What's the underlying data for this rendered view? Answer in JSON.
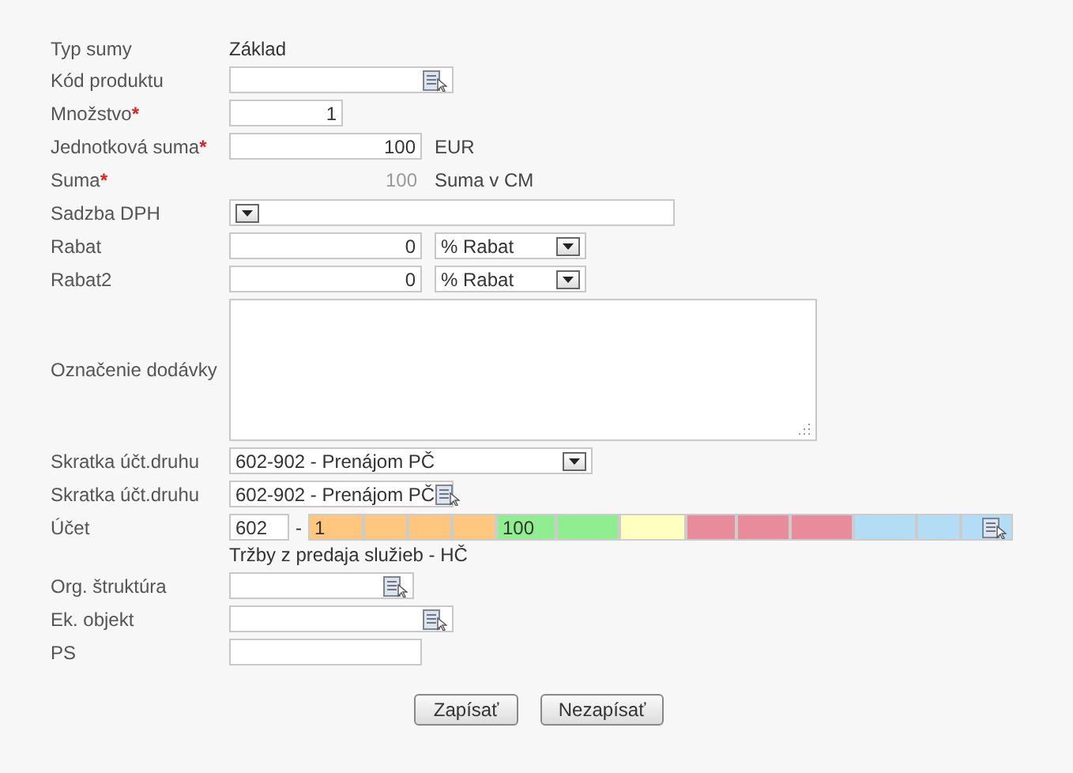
{
  "fields": [
    {
      "kind": "static",
      "label": "Typ sumy",
      "value": "Základ"
    },
    {
      "kind": "lookup",
      "label": "Kód produktu"
    },
    {
      "kind": "number",
      "label": "Množstvo",
      "required_mark": "*",
      "value": "1"
    },
    {
      "kind": "number",
      "label": "Jednotková suma",
      "required_mark": "*",
      "value": "100",
      "unit": "EUR"
    },
    {
      "kind": "readonly",
      "label": "Suma",
      "required_mark": "*",
      "value": "100",
      "unit": "Suma v CM"
    },
    {
      "kind": "select",
      "label": "Sadzba DPH"
    },
    {
      "kind": "number_select",
      "label": "Rabat",
      "value": "0",
      "option": "% Rabat"
    },
    {
      "kind": "number_select",
      "label": "Rabat2",
      "value": "0",
      "option": "% Rabat"
    },
    {
      "kind": "textarea",
      "label": "Označenie dodávky"
    },
    {
      "kind": "select",
      "label": "Skratka účt.druhu",
      "value": "602-902 - Prenájom PČ"
    },
    {
      "kind": "lookup",
      "label": "Skratka účt.druhu",
      "value": "602-902 - Prenájom PČ"
    },
    {
      "kind": "account",
      "label": "Účet",
      "prefix": "602",
      "separator": "-",
      "note": "Tržby z predaja služieb - HČ",
      "segments": [
        {
          "color": "#ffc67f",
          "value": "1"
        },
        {
          "color": "#ffc67f"
        },
        {
          "color": "#ffc67f"
        },
        {
          "color": "#ffc67f"
        },
        {
          "color": "#90ee90",
          "value": "100"
        },
        {
          "color": "#90ee90"
        },
        {
          "color": "#ffffc0"
        },
        {
          "color": "#e88b9b"
        },
        {
          "color": "#e88b9b"
        },
        {
          "color": "#e88b9b"
        },
        {
          "color": "#b3dcf5"
        },
        {
          "color": "#b3dcf5"
        },
        {
          "color": "#b3dcf5"
        }
      ]
    },
    {
      "kind": "lookup",
      "label": "Org. štruktúra"
    },
    {
      "kind": "lookup",
      "label": "Ek. objekt"
    },
    {
      "kind": "text",
      "label": "PS"
    }
  ],
  "buttons": [
    "Zapísať",
    "Nezapísať"
  ]
}
